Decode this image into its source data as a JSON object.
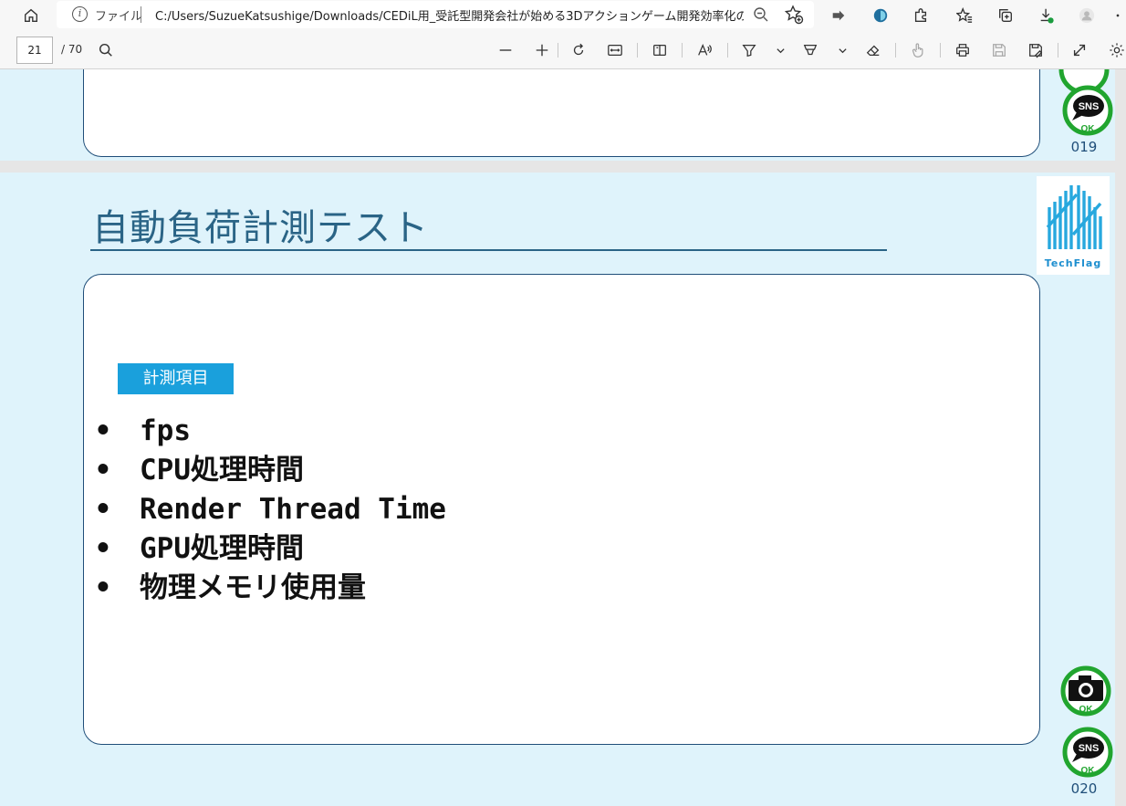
{
  "browser": {
    "file_label": "ファイル",
    "url": "C:/Users/SuzueKatsushige/Downloads/CEDiL用_受託型開発会社が始める3Dアクションゲーム開発効率化のた..."
  },
  "pdf_toolbar": {
    "current_page": "21",
    "total_pages": "/ 70"
  },
  "previous_page": {
    "page_number": "019",
    "sns_badge_text": "SNS",
    "ok_text": "OK"
  },
  "current_page": {
    "title": "自動負荷計測テスト",
    "section_label": "計測項目",
    "bullets": [
      "fps",
      "CPU処理時間",
      "Render Thread Time",
      "GPU処理時間",
      "物理メモリ使用量"
    ],
    "bullet_char": "•",
    "logo_text": "TechFlag",
    "sns_badge_text": "SNS",
    "ok_text": "OK",
    "page_number": "020"
  },
  "colors": {
    "slide_bg": "#dff3fb",
    "title": "#2a6486",
    "badge": "#1aa0dc",
    "ok_green": "#21a52f",
    "box_border": "#1f4e79"
  }
}
